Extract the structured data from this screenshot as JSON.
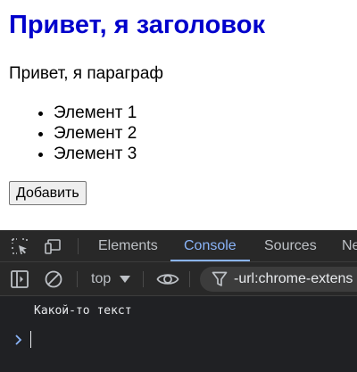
{
  "page": {
    "heading": "Привет, я заголовок",
    "paragraph": "Привет, я параграф",
    "list_items": [
      "Элемент 1",
      "Элемент 2",
      "Элемент 3"
    ],
    "button_label": "Добавить",
    "colors": {
      "heading": "#0000cc"
    }
  },
  "devtools": {
    "tabs": [
      {
        "label": "Elements",
        "active": false
      },
      {
        "label": "Console",
        "active": true
      },
      {
        "label": "Sources",
        "active": false
      },
      {
        "label": "Ne",
        "active": false
      }
    ],
    "toolbar": {
      "icons": [
        "sidebar-toggle-icon",
        "clear-console-icon",
        "eye-icon",
        "filter-icon"
      ],
      "context": "top",
      "filter_value": "-url:chrome-extens"
    },
    "console": {
      "messages": [
        "Какой-то текст"
      ],
      "prompt_symbol": "›"
    },
    "colors": {
      "accent": "#8ab4f8",
      "background": "#202124",
      "text": "#e8eaed"
    }
  }
}
